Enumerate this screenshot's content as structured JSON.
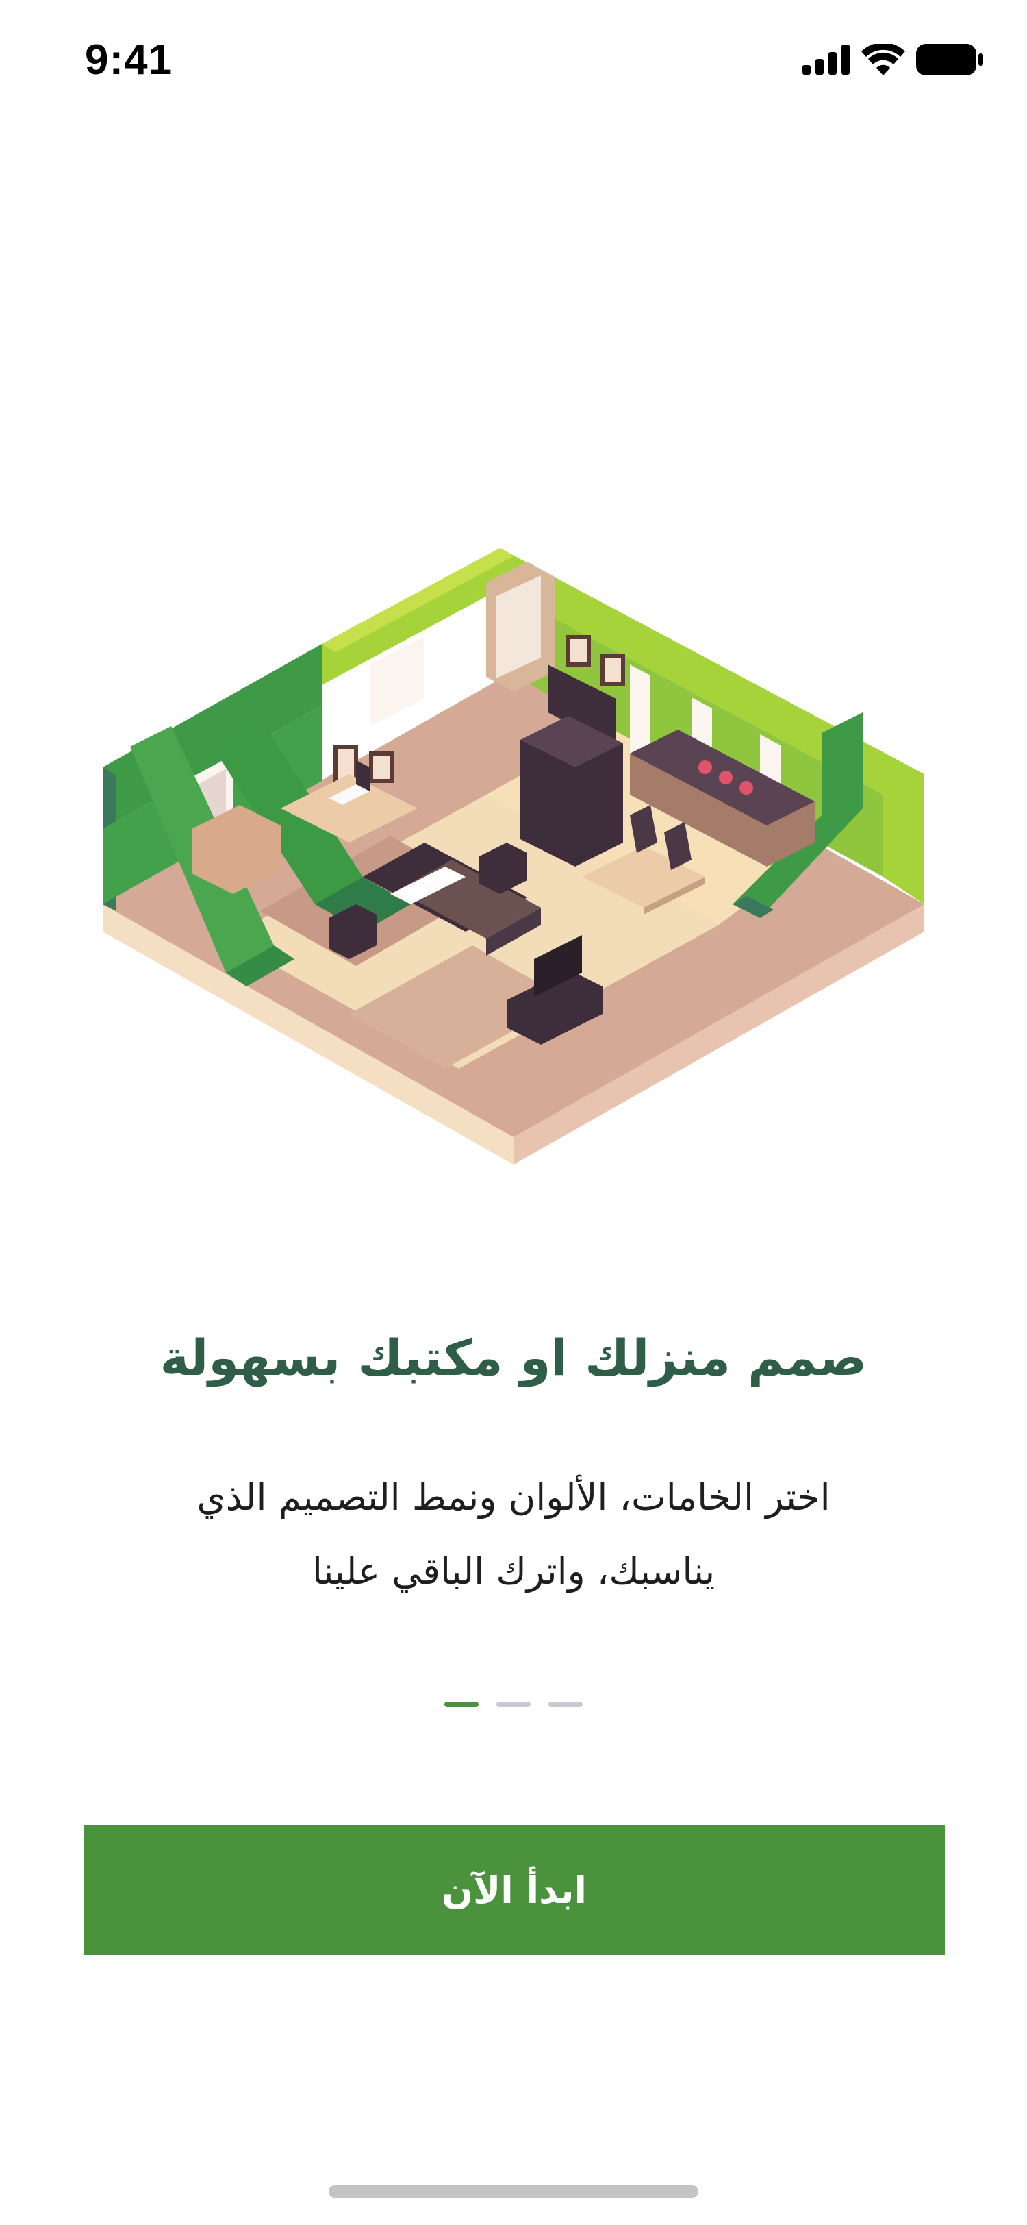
{
  "status_bar": {
    "time": "9:41",
    "icons": [
      "cellular-signal-icon",
      "wifi-icon",
      "battery-icon"
    ]
  },
  "illustration": {
    "icon": "isometric-house-interior-illustration"
  },
  "onboarding": {
    "title": "صمم منزلك او مكتبك بسهولة",
    "description_line1": "اختر الخامات، الألوان ونمط التصميم الذي",
    "description_line2": "يناسبك، واترك الباقي علينا",
    "pager": {
      "total": 3,
      "active_index": 0
    },
    "start_button_label": "ابدأ الآن"
  },
  "colors": {
    "primary": "#4a933c",
    "title": "#2f5e48",
    "text": "#1e1e1e",
    "dot_inactive": "#c8c9d1",
    "home_indicator": "#c4c4c4"
  }
}
